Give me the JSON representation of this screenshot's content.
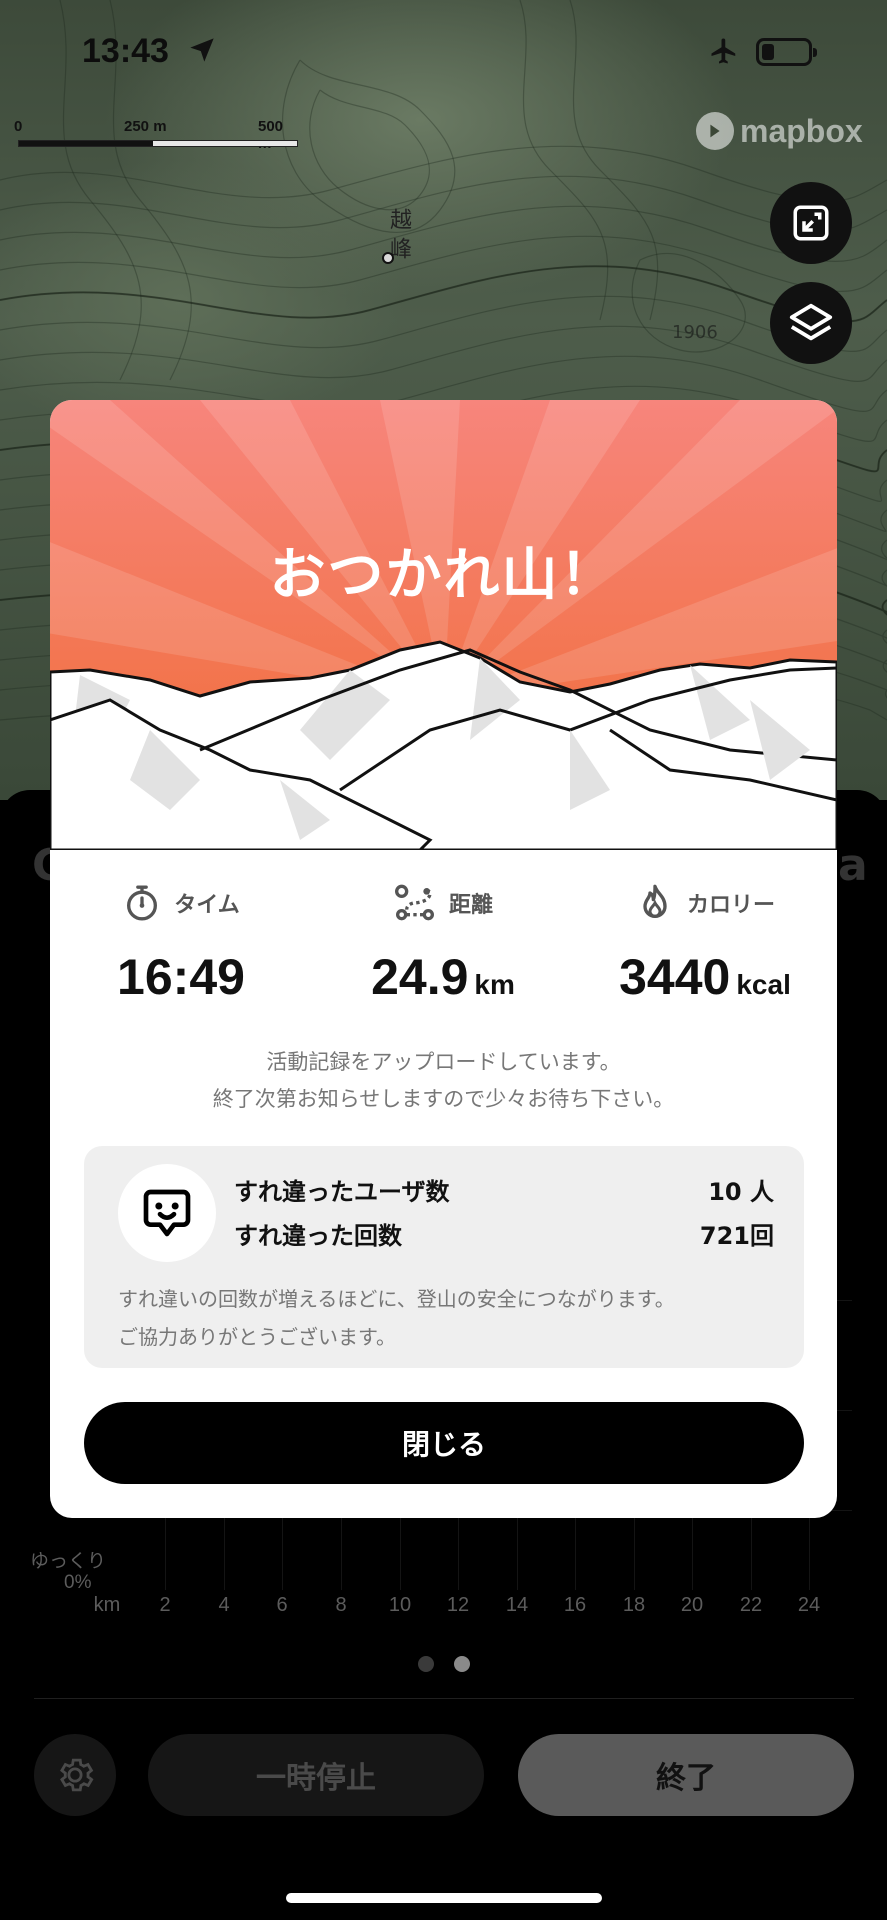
{
  "status_bar": {
    "time": "13:43",
    "icons": [
      "location-arrow-icon",
      "airplane-icon",
      "battery-icon"
    ]
  },
  "map": {
    "scale_labels": [
      "0",
      "250 m",
      "500 m"
    ],
    "attribution": "mapbox",
    "peak_label": "越 峰",
    "elevation_label": "1906",
    "buttons": [
      "fullscreen-exit-icon",
      "layers-icon"
    ]
  },
  "modal": {
    "title": "おつかれ山！",
    "stats": {
      "time_label": "タイム",
      "time_value": "16:49",
      "distance_label": "距離",
      "distance_value": "24.9",
      "distance_unit": "km",
      "calorie_label": "カロリー",
      "calorie_value": "3440",
      "calorie_unit": "kcal"
    },
    "upload_message_line1": "活動記録をアップロードしています。",
    "upload_message_line2": "終了次第お知らせしますので少々お待ち下さい。",
    "passing": {
      "users_label": "すれ違ったユーザ数",
      "users_value": "10 人",
      "count_label": "すれ違った回数",
      "count_value": "721回",
      "note_line1": "すれ違いの回数が増えるほどに、登山の安全につながります。",
      "note_line2": "ご協力ありがとうございます。"
    },
    "close_label": "閉じる"
  },
  "background_sheet": {
    "pace_label": "ゆっくり",
    "y_bottom_label": "0%",
    "x_unit": "km",
    "x_ticks": [
      "2",
      "4",
      "6",
      "8",
      "10",
      "12",
      "14",
      "16",
      "18",
      "20",
      "22",
      "24"
    ],
    "pause_label": "一時停止",
    "end_label": "終了",
    "page_count": 2,
    "active_page": 2
  },
  "colors": {
    "hero_top": "#f7857c",
    "hero_bottom": "#f06b32",
    "modal_bg": "#ffffff",
    "button_black": "#000000",
    "info_box": "#efefef"
  }
}
